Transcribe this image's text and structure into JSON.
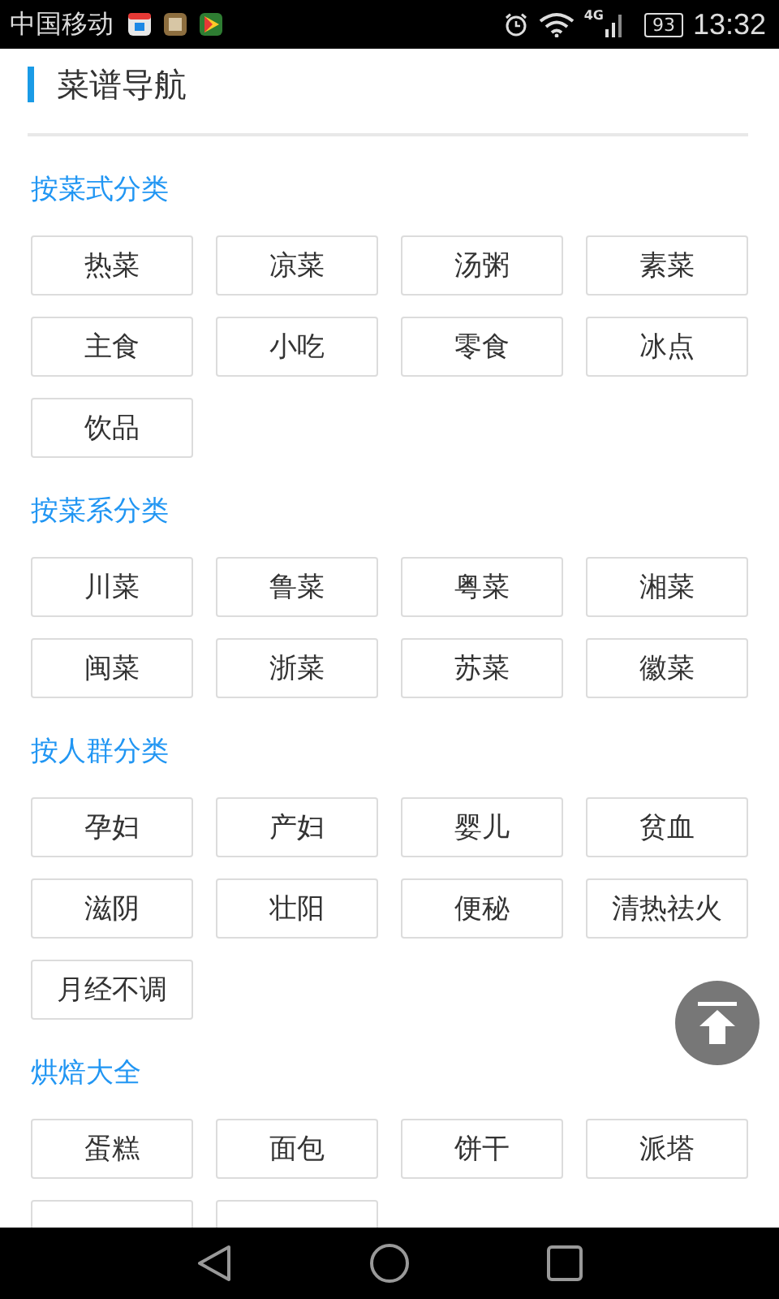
{
  "status_bar": {
    "carrier": "中国移动",
    "network": "4G",
    "battery": "93",
    "time": "13:32"
  },
  "title": "菜谱导航",
  "sections": [
    {
      "title": "按菜式分类",
      "items": [
        "热菜",
        "凉菜",
        "汤粥",
        "素菜",
        "主食",
        "小吃",
        "零食",
        "冰点",
        "饮品"
      ]
    },
    {
      "title": "按菜系分类",
      "items": [
        "川菜",
        "鲁菜",
        "粤菜",
        "湘菜",
        "闽菜",
        "浙菜",
        "苏菜",
        "徽菜"
      ]
    },
    {
      "title": "按人群分类",
      "items": [
        "孕妇",
        "产妇",
        "婴儿",
        "贫血",
        "滋阴",
        "壮阳",
        "便秘",
        "清热祛火",
        "月经不调"
      ]
    },
    {
      "title": "烘焙大全",
      "items": [
        "蛋糕",
        "面包",
        "饼干",
        "派塔"
      ],
      "cut_off_items": [
        {
          "kind": "button"
        },
        {
          "kind": "button"
        }
      ]
    }
  ]
}
